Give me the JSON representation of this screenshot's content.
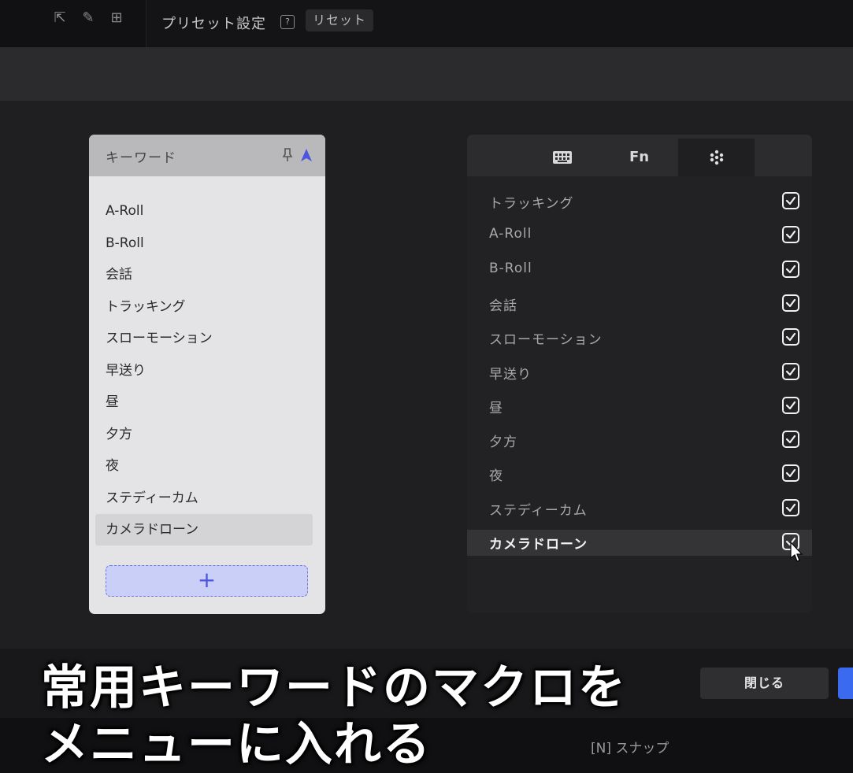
{
  "header": {
    "preset_title": "プリセット設定",
    "help": "?",
    "reset_label": "リセット"
  },
  "keyword_panel": {
    "title": "キーワード",
    "items": [
      "A-Roll",
      "B-Roll",
      "会話",
      "トラッキング",
      "スローモーション",
      "早送り",
      "昼",
      "夕方",
      "夜",
      "ステディーカム",
      "カメラドローン"
    ],
    "selected_index": 10,
    "add_label": "+"
  },
  "menu_panel": {
    "tabs": [
      {
        "label": "",
        "icon": "keyboard-icon"
      },
      {
        "label": "Fn",
        "icon": ""
      },
      {
        "label": "",
        "icon": "dots-grid-icon",
        "active": true
      }
    ],
    "items": [
      {
        "label": "トラッキング",
        "checked": true
      },
      {
        "label": "A-Roll",
        "checked": true
      },
      {
        "label": "B-Roll",
        "checked": true
      },
      {
        "label": "会話",
        "checked": true
      },
      {
        "label": "スローモーション",
        "checked": true
      },
      {
        "label": "早送り",
        "checked": true
      },
      {
        "label": "昼",
        "checked": true
      },
      {
        "label": "夕方",
        "checked": true
      },
      {
        "label": "夜",
        "checked": true
      },
      {
        "label": "ステディーカム",
        "checked": true
      },
      {
        "label": "カメラドローン",
        "checked": true,
        "selected": true
      }
    ]
  },
  "footer": {
    "close_label": "閉じる",
    "snap_label": "[N] スナップ"
  },
  "caption": {
    "line1": "常用キーワードのマクロを",
    "line2": "メニューに入れる"
  },
  "colors": {
    "accent": "#3a6af0",
    "add_button_fill": "#c9cff6"
  }
}
